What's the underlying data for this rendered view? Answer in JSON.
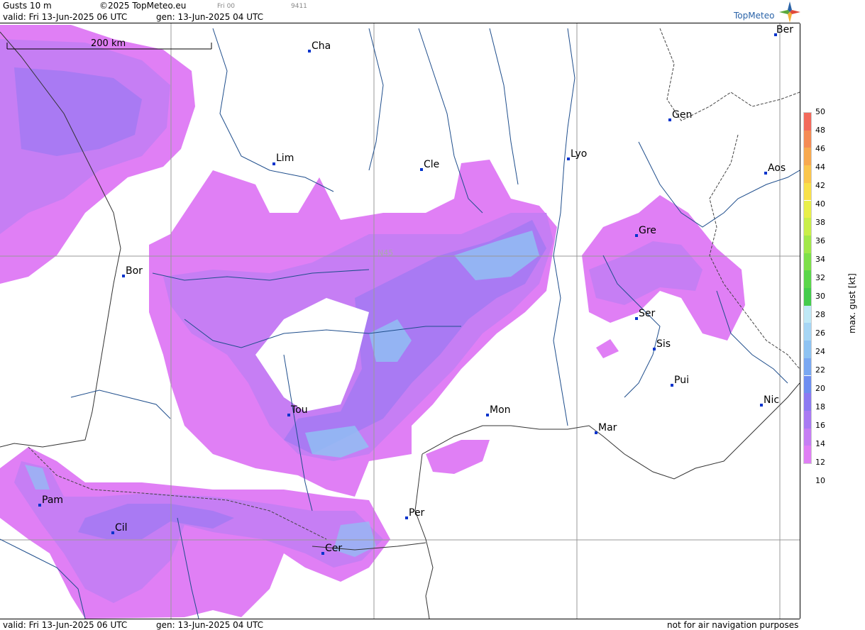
{
  "header": {
    "product": "Gusts 10 m",
    "copyright": "©2025 TopMeteo.eu",
    "forecast_step": "Fri 00",
    "code": "9411",
    "valid": "valid:  Fri  13-Jun-2025  06 UTC",
    "generated": "gen: 13-Jun-2025 04 UTC",
    "brand": "TopMeteo"
  },
  "map": {
    "scale_label": "200 km",
    "lat_label": "N45",
    "cities": [
      "Ber",
      "Cha",
      "Gen",
      "Lim",
      "Cle",
      "Lyo",
      "Aos",
      "Gre",
      "Bor",
      "Ser",
      "Sis",
      "Pui",
      "Tou",
      "Mon",
      "Nic",
      "Mar",
      "Pam",
      "Per",
      "Cil",
      "Cer"
    ]
  },
  "footer": {
    "valid": "valid:  Fri  13-Jun-2025  06 UTC",
    "generated": "gen: 13-Jun-2025 04 UTC",
    "disclaimer": "not for air navigation purposes"
  },
  "legend": {
    "title": "max. gust [kt]",
    "ticks": [
      "50",
      "48",
      "46",
      "44",
      "42",
      "40",
      "38",
      "36",
      "34",
      "32",
      "30",
      "28",
      "26",
      "24",
      "22",
      "20",
      "18",
      "16",
      "14",
      "12",
      "10"
    ],
    "colors": [
      "#f36a5c",
      "#f58b55",
      "#f8a94f",
      "#fbc64c",
      "#f9e14a",
      "#e9ef4a",
      "#c9ee4a",
      "#a2e84a",
      "#7ee04a",
      "#5ad64a",
      "#44cc4c",
      "#bfe9f6",
      "#a6d6f5",
      "#8ec3f3",
      "#7aa8f2",
      "#6e8ef1",
      "#8c7af2",
      "#a97af3",
      "#c67ef4",
      "#e07ff5"
    ]
  }
}
